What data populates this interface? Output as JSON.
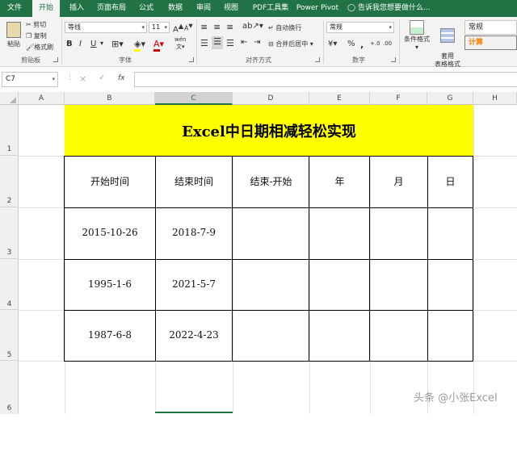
{
  "ribbon_tabs": [
    "文件",
    "开始",
    "插入",
    "页面布局",
    "公式",
    "数据",
    "审阅",
    "视图",
    "PDF工具集",
    "Power Pivot",
    "告诉我您想要做什么..."
  ],
  "clipboard": {
    "paste": "粘贴",
    "cut": "剪切",
    "copy": "复制",
    "format_painter": "格式刷",
    "group": "剪贴板"
  },
  "font": {
    "name": "等线",
    "size": "11",
    "bold": "B",
    "italic": "I",
    "underline": "U",
    "group": "字体",
    "grow": "A",
    "shrink": "A",
    "wen": "wén"
  },
  "alignment": {
    "wrap": "自动换行",
    "merge": "合并后居中",
    "group": "对齐方式"
  },
  "number": {
    "format": "常规",
    "group": "数字",
    "percent": "%",
    "comma": ","
  },
  "styles": {
    "conditional": "条件格式",
    "table": "套用\n表格格式",
    "cell_normal": "常规",
    "cell_calc": "计算"
  },
  "formula_bar": {
    "name_box": "C7",
    "cancel": "×",
    "enter": "✓",
    "fx": "fx",
    "value": ""
  },
  "columns": [
    "A",
    "B",
    "C",
    "D",
    "E",
    "F",
    "G",
    "H"
  ],
  "rows": [
    "1",
    "2",
    "3",
    "4",
    "5",
    "6"
  ],
  "sheet": {
    "title": "Excel中日期相减轻松实现",
    "headers": [
      "开始时间",
      "结束时间",
      "结束-开始",
      "年",
      "月",
      "日"
    ],
    "data": [
      [
        "2015-10-26",
        "2018-7-9",
        "",
        "",
        "",
        ""
      ],
      [
        "1995-1-6",
        "2021-5-7",
        "",
        "",
        "",
        ""
      ],
      [
        "1987-6-8",
        "2022-4-23",
        "",
        "",
        "",
        ""
      ]
    ]
  },
  "watermark": "头条 @小张Excel",
  "colors": {
    "excel_green": "#217346",
    "title_fill": "#ffff00"
  }
}
